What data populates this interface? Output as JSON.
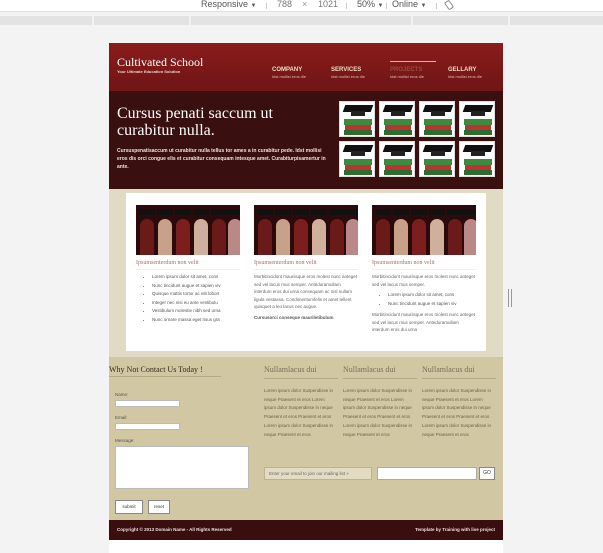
{
  "devtools": {
    "device": "Responsive",
    "width": "788",
    "times": "×",
    "height": "1021",
    "zoom": "50%",
    "network": "Online",
    "dropdown_arrow": "▼",
    "rotate_icon": "rotate-icon"
  },
  "site": {
    "title": "Cultivated School",
    "tagline": "Your Ultimate Education Solution",
    "nav": [
      {
        "label": "COMPANY",
        "sub": "Idst mollisi eros dle"
      },
      {
        "label": "SERVICES",
        "sub": "Idst mollisi eros dle"
      },
      {
        "label": "PROJECTS",
        "sub": "Idst mollisi eros dle"
      },
      {
        "label": "GELLARY",
        "sub": "Idst mollisi eros dle"
      }
    ]
  },
  "hero": {
    "title": "Cursus penati saccum ut curabitur nulla.",
    "text": "Cursuspenatisaccum ut curabitur nulla tellus tor ames a in curabitur pede. Idst mollisi eros dis orci congue elis et curabitur consequam intesque amet. Curabiturpisamertur in ante."
  },
  "cards": [
    {
      "title": "Ipsumsenterdum non velit",
      "list": [
        "Lorem ipsum dolor sit amet, cons",
        "Nunc tincidunt augue et sapien viv",
        "Quisque mattis tortor ac elit lobort",
        "Integer nec nisi eu ante vestibulu",
        "Vestibulum molestie nibh sed urna",
        "Nunc ornare massa eget risus gra"
      ]
    },
    {
      "title": "Ipsumsenterdum non velit",
      "text": "Morbitincidunt mauriisque eros molest nunc anteget sed vel lacus mus semper. Anteduramullam interdum eros dui urna consequam ac nisl nullam ligula vestassa. Condimentumfelis et amet tellent quisquet a leo lacus nec augue.",
      "strong": "Cursusorci conseque mauriletibulum"
    },
    {
      "title": "Ipsumsenterdum non velit",
      "text": "Morbitincidunt mauriisque eros molest nunc anteget sed vel lacus mus semper.",
      "list": [
        "Lorem ipsum dolor sit amet, cons",
        "Nunc tincidunt augue et sapien viv"
      ],
      "text2": "Morbitincidunt mauriisque eros molest nunc anteget sed vel lacus mus semper. Anteduramullam interdum eros dui urna"
    }
  ],
  "contact": {
    "title": "Why Not Contact Us Today !",
    "name_label": "Name:",
    "email_label": "Email:",
    "message_label": "Message:",
    "submit": "submit",
    "reset": "reset"
  },
  "columns": [
    {
      "title": "Nullamlacus dui",
      "text": "Lorem ipsum dolor Suspendisse in neque Praesent et eros Lorem ipsum dolor Suspendisse in neque Praesent et eros Praesent et eros Lorem ipsum dolor Suspendisse in neque Praesent et eros"
    },
    {
      "title": "Nullamlacus dui",
      "text": "Lorem ipsum dolor Suspendisse in neque Praesent et eros Lorem ipsum dolor Suspendisse in neque Praesent et eros Praesent et eros Lorem ipsum dolor Suspendisse in neque Praesent et eros"
    },
    {
      "title": "Nullamlacus dui",
      "text": "Lorem ipsum dolor Suspendisse in neque Praesent et eros Lorem ipsum dolor Suspendisse in neque Praesent et eros Praesent et eros Lorem ipsum dolor Suspendisse in neque Praesent et eros"
    }
  ],
  "mailing": {
    "placeholder": "Enter your email to join our mailing list »",
    "go": "GO"
  },
  "footer": {
    "copyright": "Copyright © 2013 Domain Name - All Rights Reserved",
    "credit": "Template by Training with live project"
  }
}
